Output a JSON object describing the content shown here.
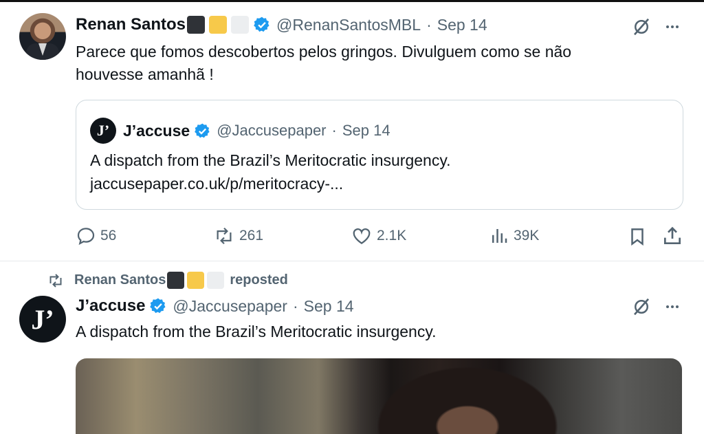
{
  "tweet1": {
    "author_name": "Renan Santos",
    "handle": "@RenanSantosMBL",
    "separator": "·",
    "date": "Sep 14",
    "text_line1": "Parece que fomos descobertos pelos gringos. Divulguem como se não",
    "text_line2": "houvesse amanhã !",
    "quote": {
      "logo_text": "J’",
      "author_name": "J’accuse",
      "handle": "@Jaccusepaper",
      "separator": "·",
      "date": "Sep 14",
      "text_line1": "A dispatch from the Brazil’s Meritocratic insurgency.",
      "text_line2": "jaccusepaper.co.uk/p/meritocracy-..."
    },
    "actions": {
      "replies": "56",
      "reposts": "261",
      "likes": "2.1K",
      "views": "39K"
    }
  },
  "tweet2": {
    "reposted_by": "Renan Santos",
    "reposted_label": "reposted",
    "logo_text": "J’",
    "author_name": "J’accuse",
    "handle": "@Jaccusepaper",
    "separator": "·",
    "date": "Sep 14",
    "text": "A dispatch from the Brazil’s Meritocratic insurgency."
  },
  "colors": {
    "verified": "#1d9bf0",
    "secondary_text": "#536471",
    "primary_text": "#0f1419",
    "flag_dark": "#2f3237",
    "flag_yellow": "#f7c94a",
    "flag_white": "#eceef0"
  },
  "icons": [
    "verified-badge-icon",
    "grok-icon",
    "more-icon",
    "reply-icon",
    "repost-icon",
    "like-icon",
    "views-icon",
    "bookmark-icon",
    "share-icon"
  ]
}
